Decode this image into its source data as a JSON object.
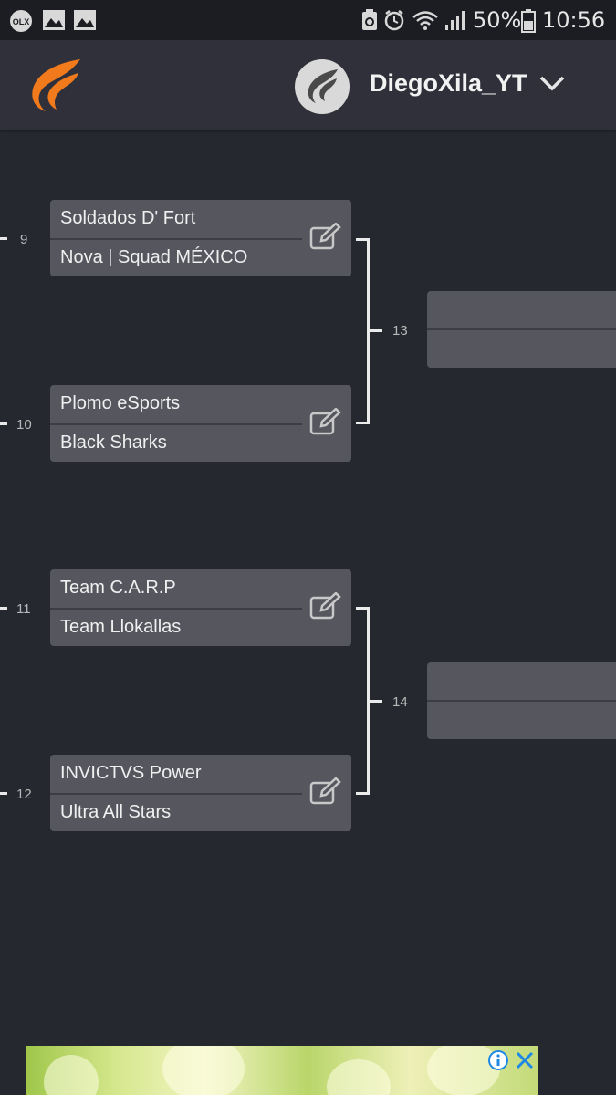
{
  "status_bar": {
    "left_icons": [
      "olx-icon",
      "gallery-icon",
      "gallery-icon"
    ],
    "right_icons": [
      "recycle-icon",
      "alarm-icon",
      "wifi-icon",
      "signal-icon",
      "battery-icon"
    ],
    "battery": "50%",
    "time": "10:56"
  },
  "header": {
    "username": "DiegoXila_YT",
    "accent_color": "#f07a1c"
  },
  "bracket": {
    "matches": [
      {
        "number": "9",
        "team1": "Soldados D' Fort",
        "team2": "Nova | Squad MÉXICO"
      },
      {
        "number": "10",
        "team1": "Plomo eSports",
        "team2": "Black Sharks"
      },
      {
        "number": "11",
        "team1": "Team C.A.R.P",
        "team2": "Team Llokallas"
      },
      {
        "number": "12",
        "team1": "INVICTVS Power",
        "team2": "Ultra All Stars"
      }
    ],
    "next_round": [
      {
        "number": "13",
        "team1": "",
        "team2": ""
      },
      {
        "number": "14",
        "team1": "",
        "team2": ""
      }
    ]
  },
  "ad": {
    "icons": [
      "info-icon",
      "close-icon"
    ]
  }
}
